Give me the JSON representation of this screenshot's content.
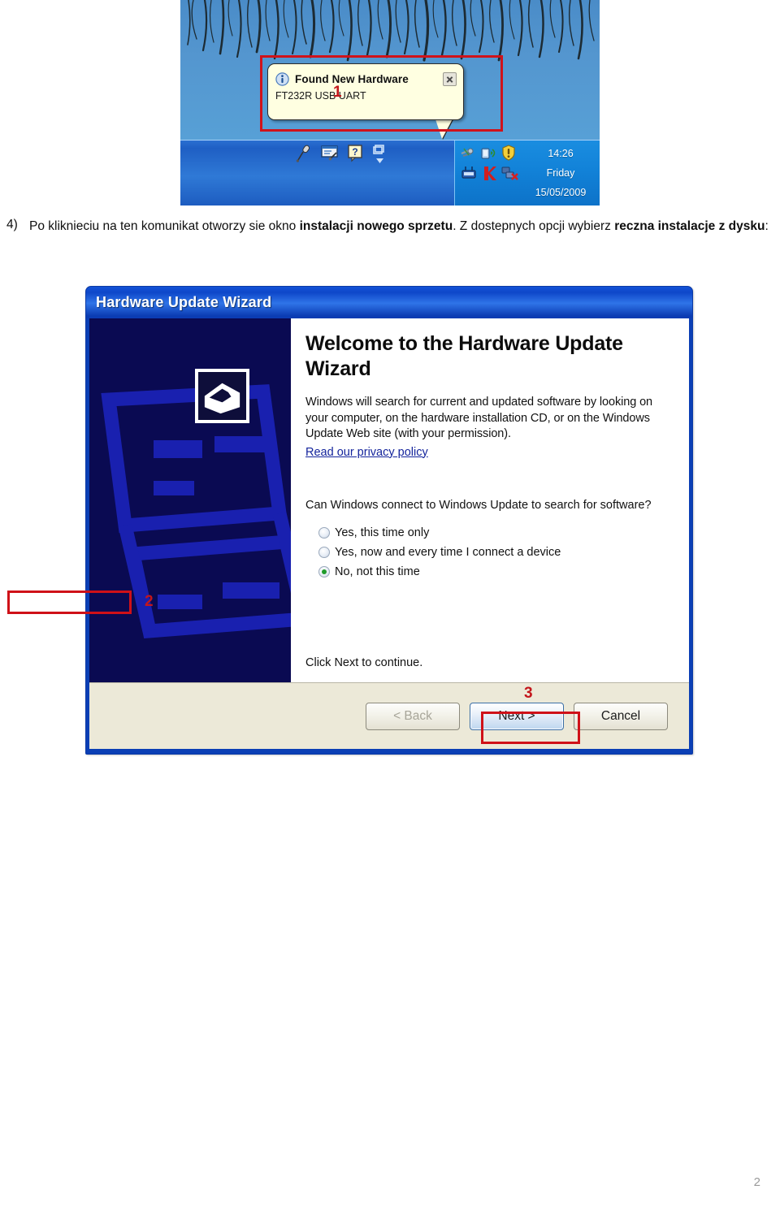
{
  "document": {
    "page_number": "2",
    "step4": {
      "marker": "4)",
      "text_before_bold1": "Po kliknieciu na ten komunikat otworzy sie okno ",
      "bold1": "instalacji nowego sprzetu",
      "text_middle": ". Z dostepnych opcji wybierz ",
      "bold2": "reczna instalacje z dysku",
      "text_after": ":"
    }
  },
  "figure1": {
    "annotation": "1",
    "balloon": {
      "icon": "info-icon",
      "title": "Found New Hardware",
      "body": "FT232R USB UART",
      "close_icon": "close-icon",
      "background": "#ffffe1"
    },
    "taskbar": {
      "quicklaunch_icons": [
        "microphone-icon",
        "notes-pen-icon",
        "help-question-icon",
        "show-desktop-icon"
      ],
      "tray_icons": [
        "usb-unplug-icon",
        "wireless-signal-icon",
        "security-shield-warning-icon",
        "network-device-icon",
        "kaspersky-icon",
        "network-disconnected-icon"
      ],
      "clock_time": "14:26",
      "clock_day": "Friday",
      "clock_date": "15/05/2009"
    },
    "desktop_background_color": "#4d90cc"
  },
  "figure2": {
    "window_title": "Hardware Update Wizard",
    "titlebar_color": "#0e47c9",
    "side_panel_color": "#0a0a52",
    "side_icon": "hardware-wizard-icon",
    "heading": "Welcome to the Hardware Update Wizard",
    "paragraph": "Windows will search for current and updated software by looking on your computer, on the hardware installation CD, or on the Windows Update Web site (with your permission).",
    "privacy_link": "Read our privacy policy",
    "question": "Can Windows connect to Windows Update to search for software?",
    "options": [
      {
        "label": "Yes, this time only",
        "checked": false
      },
      {
        "label": "Yes, now and every time I connect a device",
        "checked": false
      },
      {
        "label": "No, not this time",
        "checked": true
      }
    ],
    "footnote": "Click Next to continue.",
    "buttons": [
      {
        "label": "< Back",
        "state": "disabled"
      },
      {
        "label": "Next >",
        "state": "default"
      },
      {
        "label": "Cancel",
        "state": "normal"
      }
    ],
    "annotation_option": "2",
    "annotation_button": "3",
    "annotation_color": "#cf1118"
  }
}
